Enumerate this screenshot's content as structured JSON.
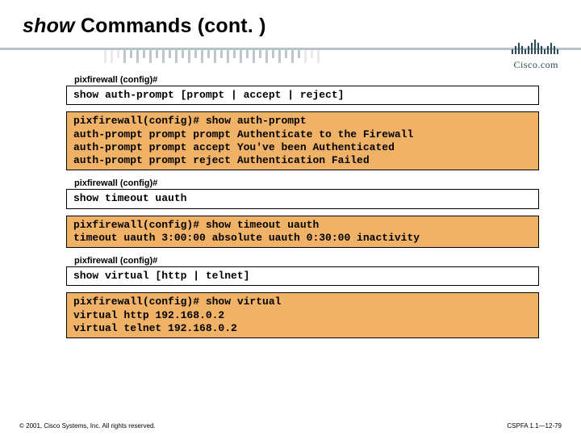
{
  "title": {
    "italic_word": "show",
    "rest": " Commands (cont. )"
  },
  "logo_text": "Cisco.com",
  "sections": [
    {
      "prompt": "pixfirewall (config)#",
      "command": "show auth-prompt [prompt | accept | reject]",
      "output": "pixfirewall(config)# show auth-prompt\nauth-prompt prompt prompt Authenticate to the Firewall\nauth-prompt prompt accept You've been Authenticated\nauth-prompt prompt reject Authentication Failed"
    },
    {
      "prompt": "pixfirewall (config)#",
      "command": "show timeout uauth",
      "output": "pixfirewall(config)# show timeout uauth\ntimeout uauth 3:00:00 absolute uauth 0:30:00 inactivity"
    },
    {
      "prompt": "pixfirewall (config)#",
      "command": "show virtual [http | telnet]",
      "output": "pixfirewall(config)# show virtual\nvirtual http 192.168.0.2\nvirtual telnet 192.168.0.2"
    }
  ],
  "footer": {
    "left": "© 2001, Cisco Systems, Inc. All rights reserved.",
    "right": "CSPFA 1.1—12-79"
  }
}
